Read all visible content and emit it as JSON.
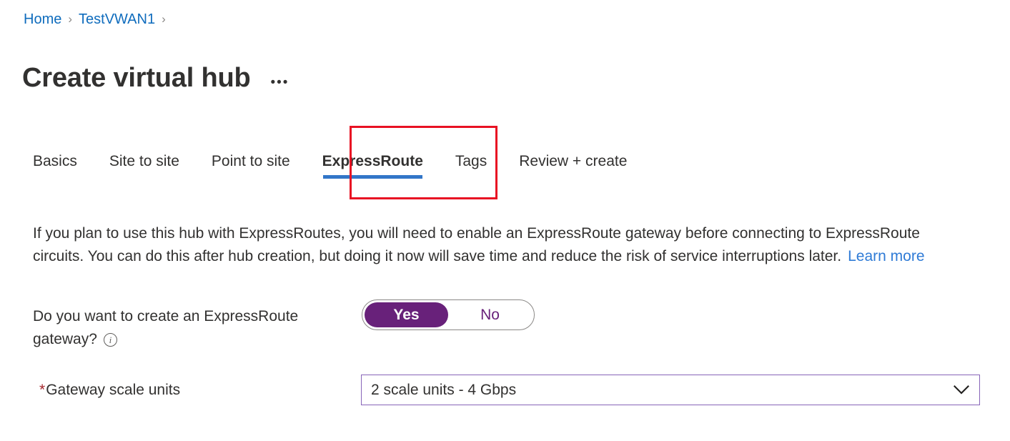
{
  "breadcrumb": {
    "items": [
      {
        "label": "Home"
      },
      {
        "label": "TestVWAN1"
      }
    ],
    "separator": "›"
  },
  "header": {
    "title": "Create virtual hub",
    "more_label": "•••",
    "more_icon": "ellipsis-icon"
  },
  "tabs": [
    {
      "label": "Basics",
      "selected": false
    },
    {
      "label": "Site to site",
      "selected": false
    },
    {
      "label": "Point to site",
      "selected": false
    },
    {
      "label": "ExpressRoute",
      "selected": true
    },
    {
      "label": "Tags",
      "selected": false
    },
    {
      "label": "Review + create",
      "selected": false
    }
  ],
  "description": {
    "text": "If you plan to use this hub with ExpressRoutes, you will need to enable an ExpressRoute gateway before connecting to ExpressRoute circuits. You can do this after hub creation, but doing it now will save time and reduce the risk of service interruptions later.",
    "link_label": "Learn more"
  },
  "form": {
    "gateway_toggle": {
      "label": "Do you want to create an ExpressRoute gateway?",
      "info_icon": "info-icon",
      "info_glyph": "i",
      "options": [
        {
          "label": "Yes",
          "selected": true
        },
        {
          "label": "No",
          "selected": false
        }
      ]
    },
    "scale_units": {
      "required_marker": "*",
      "label": "Gateway scale units",
      "value": "2 scale units - 4 Gbps",
      "chevron_icon": "chevron-down-icon"
    }
  },
  "colors": {
    "link": "#0f6cbd",
    "learn_more_link": "#2f7bd6",
    "tab_underline": "#3276c8",
    "toggle_accent": "#68217a",
    "dropdown_border": "#8764b8",
    "required_star": "#a4262c",
    "annotation_box": "#e81123",
    "text": "#323130"
  }
}
